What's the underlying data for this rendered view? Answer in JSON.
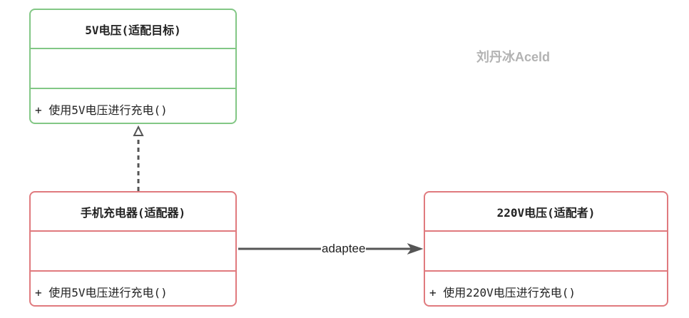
{
  "classes": {
    "target": {
      "name": "5V电压(适配目标)",
      "method": "+ 使用5V电压进行充电()"
    },
    "adapter": {
      "name": "手机充电器(适配器)",
      "method": "+ 使用5V电压进行充电()"
    },
    "adaptee": {
      "name": "220V电压(适配者)",
      "method": "+ 使用220V电压进行充电()"
    }
  },
  "edges": {
    "realization": {
      "from": "adapter",
      "to": "target",
      "style": "dashed",
      "head": "hollow-triangle"
    },
    "association": {
      "from": "adapter",
      "to": "adaptee",
      "label": "adaptee",
      "head": "filled-arrow"
    }
  },
  "watermark": "刘丹冰Aceld",
  "colors": {
    "target_border": "#82c785",
    "adapter_border": "#e07a7e",
    "adaptee_border": "#e07a7e",
    "edge": "#555555",
    "watermark": "#b3b3b3"
  }
}
